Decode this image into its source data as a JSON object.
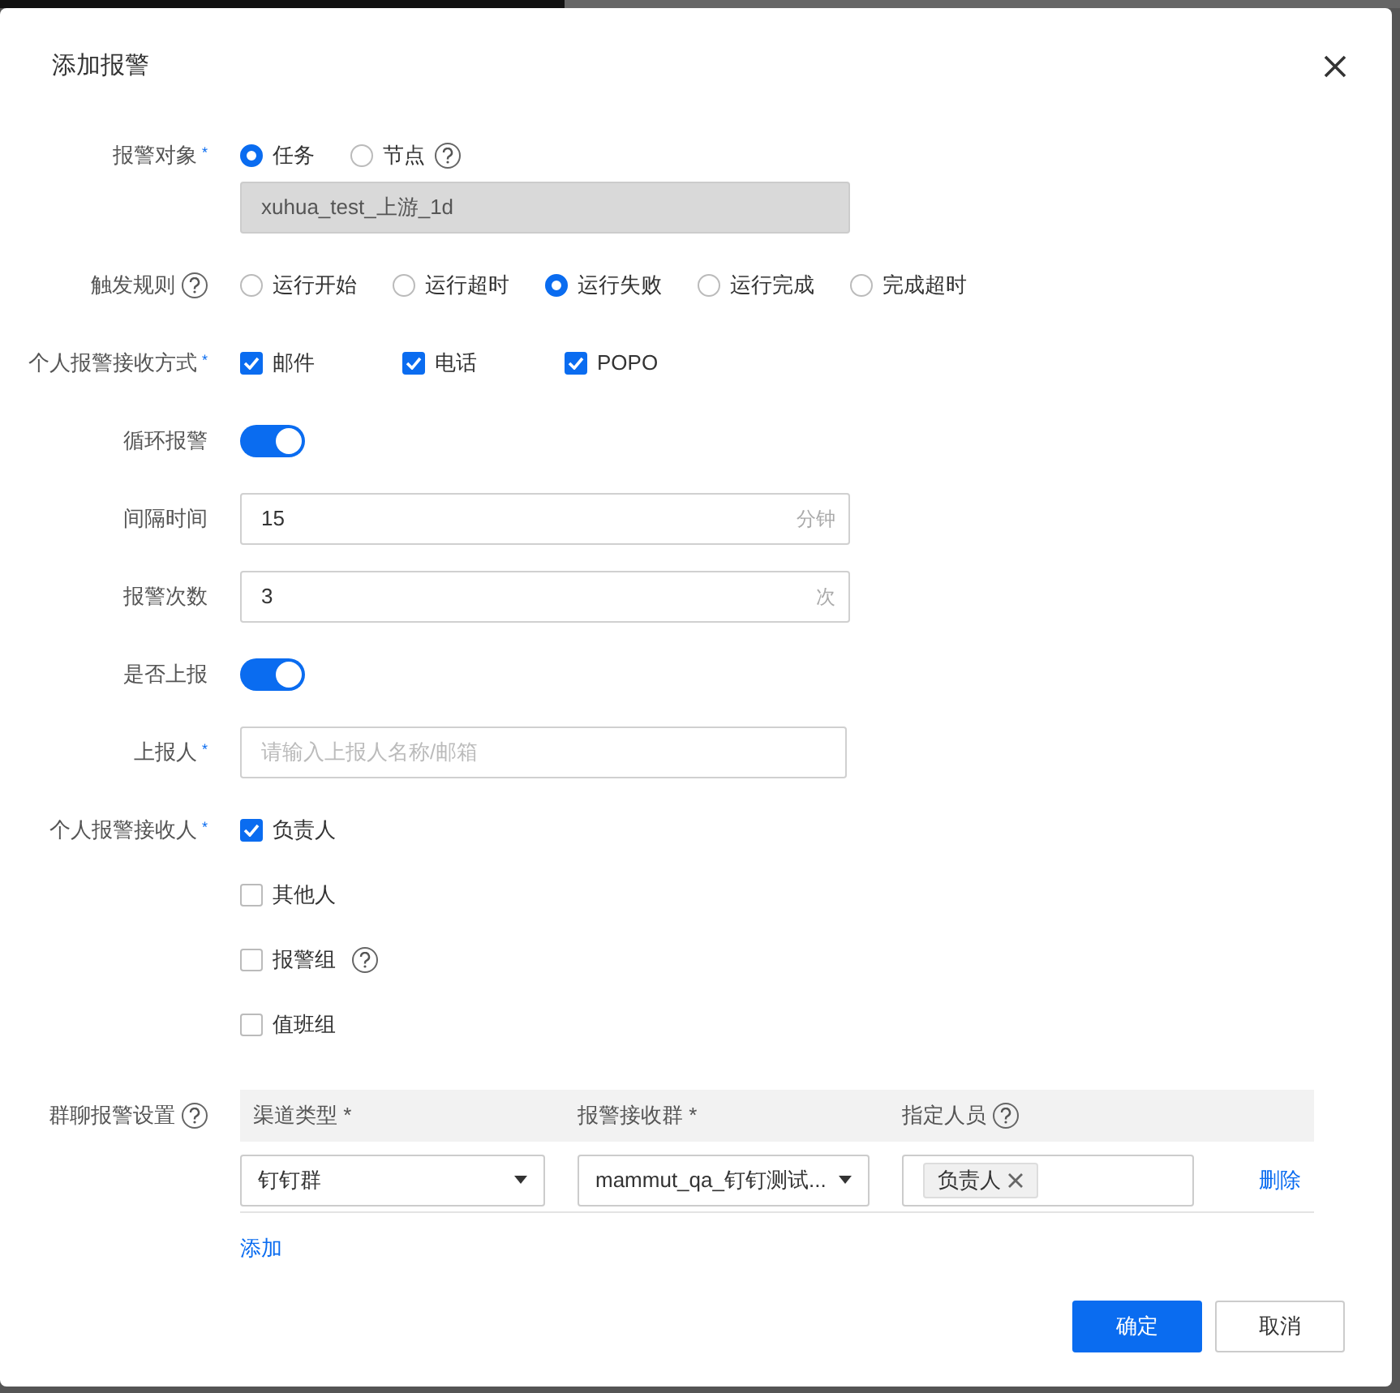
{
  "dialog": {
    "title": "添加报警"
  },
  "fields": [
    {
      "kind": "radio",
      "label": "报警对象",
      "required_mark": "*",
      "options": [
        {
          "label": "任务",
          "selected": true
        },
        {
          "label": "节点",
          "selected": false,
          "help": true
        }
      ],
      "readonly_value": "xuhua_test_上游_1d"
    },
    {
      "kind": "radio",
      "label": "触发规则",
      "help": true,
      "options": [
        {
          "label": "运行开始",
          "selected": false
        },
        {
          "label": "运行超时",
          "selected": false
        },
        {
          "label": "运行失败",
          "selected": true
        },
        {
          "label": "运行完成",
          "selected": false
        },
        {
          "label": "完成超时",
          "selected": false
        }
      ]
    },
    {
      "kind": "checkbox",
      "label": "个人报警接收方式",
      "required_mark": "*",
      "options": [
        {
          "label": "邮件",
          "checked": true
        },
        {
          "label": "电话",
          "checked": true
        },
        {
          "label": "POPO",
          "checked": true
        }
      ]
    },
    {
      "kind": "switch",
      "label": "循环报警",
      "on": true
    },
    {
      "kind": "input",
      "label": "间隔时间",
      "value": "15",
      "suffix": "分钟"
    },
    {
      "kind": "input",
      "label": "报警次数",
      "value": "3",
      "suffix": "次"
    },
    {
      "kind": "switch",
      "label": "是否上报",
      "on": true
    },
    {
      "kind": "input",
      "label": "上报人",
      "required_mark": "*",
      "placeholder": "请输入上报人名称/邮箱"
    },
    {
      "kind": "checklist",
      "label": "个人报警接收人",
      "required_mark": "*",
      "options": [
        {
          "label": "负责人",
          "checked": true
        },
        {
          "label": "其他人",
          "checked": false
        },
        {
          "label": "报警组",
          "checked": false,
          "help": true
        },
        {
          "label": "值班组",
          "checked": false
        }
      ]
    }
  ],
  "group_chat": {
    "label": "群聊报警设置",
    "help": true,
    "columns": [
      {
        "label": "渠道类型 *"
      },
      {
        "label": "报警接收群 *"
      },
      {
        "label": "指定人员",
        "help": true
      }
    ],
    "rows": [
      {
        "channel": "钉钉群",
        "group": "mammut_qa_钉钉测试...",
        "people": [
          "负责人"
        ],
        "delete": "删除"
      }
    ],
    "add": "添加"
  },
  "buttons": [
    {
      "label": "确定",
      "kind": "primary"
    },
    {
      "label": "取消",
      "kind": "default"
    }
  ]
}
